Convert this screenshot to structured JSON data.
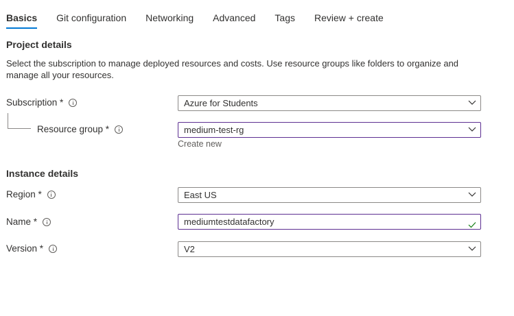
{
  "tabs": [
    {
      "label": "Basics",
      "active": true
    },
    {
      "label": "Git configuration"
    },
    {
      "label": "Networking"
    },
    {
      "label": "Advanced"
    },
    {
      "label": "Tags"
    },
    {
      "label": "Review + create"
    }
  ],
  "project": {
    "title": "Project details",
    "description": "Select the subscription to manage deployed resources and costs. Use resource groups like folders to organize and manage all your resources.",
    "subscription": {
      "label": "Subscription *",
      "value": "Azure for Students"
    },
    "resource_group": {
      "label": "Resource group *",
      "value": "medium-test-rg",
      "create_new": "Create new"
    }
  },
  "instance": {
    "title": "Instance details",
    "region": {
      "label": "Region *",
      "value": "East US"
    },
    "name": {
      "label": "Name *",
      "value": "mediumtestdatafactory"
    },
    "version": {
      "label": "Version *",
      "value": "V2"
    }
  },
  "colors": {
    "accent": "#0078d4",
    "focus_border": "#5c2e91",
    "valid_check": "#107c10"
  }
}
